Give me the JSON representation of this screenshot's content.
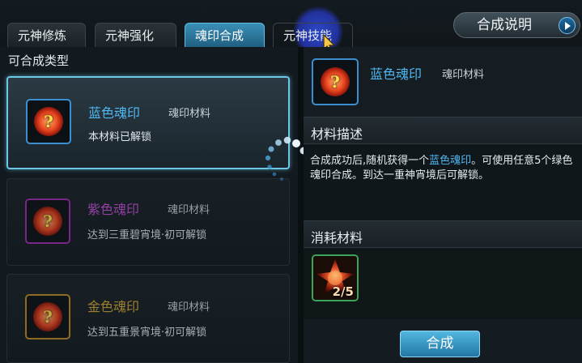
{
  "tabs": [
    {
      "label": "元神修炼",
      "active": false
    },
    {
      "label": "元神强化",
      "active": false
    },
    {
      "label": "魂印合成",
      "active": true
    },
    {
      "label": "元神技能",
      "active": false
    }
  ],
  "help_button": {
    "label": "合成说明",
    "icon": "play-arrow-icon"
  },
  "left_panel": {
    "title": "可合成类型",
    "items": [
      {
        "name": "蓝色魂印",
        "type": "魂印材料",
        "status": "本材料已解锁",
        "color": "#4fb8f0",
        "selected": true,
        "icon": "question-orb-icon"
      },
      {
        "name": "紫色魂印",
        "type": "魂印材料",
        "status": "达到三重碧宵境·初可解锁",
        "color": "#c24fd4",
        "selected": false,
        "icon": "question-orb-icon"
      },
      {
        "name": "金色魂印",
        "type": "魂印材料",
        "status": "达到五重景宵境·初可解锁",
        "color": "#d5a534",
        "selected": false,
        "icon": "question-orb-icon"
      }
    ]
  },
  "detail": {
    "name": "蓝色魂印",
    "type": "魂印材料",
    "icon": "question-orb-icon",
    "desc_section_label": "材料描述",
    "desc_part1": "合成成功后,随机获得一个",
    "desc_highlight": "蓝色魂印",
    "desc_part2": "。可使用任意5个绿色魂印合成。到达一重神宵境后可解锁。",
    "cost_section_label": "消耗材料",
    "cost_count": "2/5",
    "cost_icon": "green-soul-seal-icon",
    "compose_button": "合成"
  },
  "colors": {
    "accent": "#4fb8f0",
    "active_tab": "#3a8fb7",
    "cursor_highlight": "#3250e6"
  }
}
